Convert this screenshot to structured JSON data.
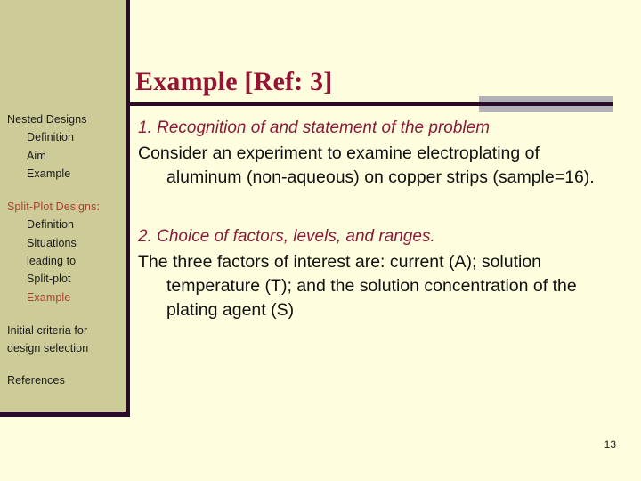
{
  "slide": {
    "title": "Example [Ref: 3]",
    "page_number": "13"
  },
  "sidebar": {
    "groups": [
      {
        "heading": "Nested Designs",
        "heading_accent": false,
        "items": [
          {
            "label": "Definition",
            "accent": false
          },
          {
            "label": "Aim",
            "accent": false
          },
          {
            "label": "Example",
            "accent": false
          }
        ]
      },
      {
        "heading": "Split-Plot Designs:",
        "heading_accent": true,
        "items": [
          {
            "label": "Definition",
            "accent": false
          },
          {
            "label": "Situations",
            "accent": false
          },
          {
            "label": "leading to",
            "accent": false
          },
          {
            "label": "Split-plot",
            "accent": false
          },
          {
            "label": "Example",
            "accent": true
          }
        ]
      }
    ],
    "standalone": [
      {
        "label": "Initial criteria for",
        "accent": false
      },
      {
        "label": "design selection",
        "accent": false
      }
    ],
    "references_label": "References"
  },
  "content": {
    "blocks": [
      {
        "lead": "1. Recognition of and statement of the problem",
        "body": "Consider an experiment to examine electroplating of aluminum (non-aqueous) on copper strips (sample=16)."
      },
      {
        "lead": "2. Choice of factors, levels, and ranges.",
        "body": "The three factors of interest are: current (A); solution temperature (T); and the solution concentration of the plating agent (S)"
      }
    ]
  },
  "colors": {
    "sidebar_background": "#CDCC99",
    "border_dark": "#2A0A28",
    "slide_background": "#FFFFE0",
    "title_crimson": "#991233",
    "lead_crimson": "#8B1A3A",
    "accent_rust": "#A8432B",
    "divider_gray": "#B3B0B8"
  }
}
